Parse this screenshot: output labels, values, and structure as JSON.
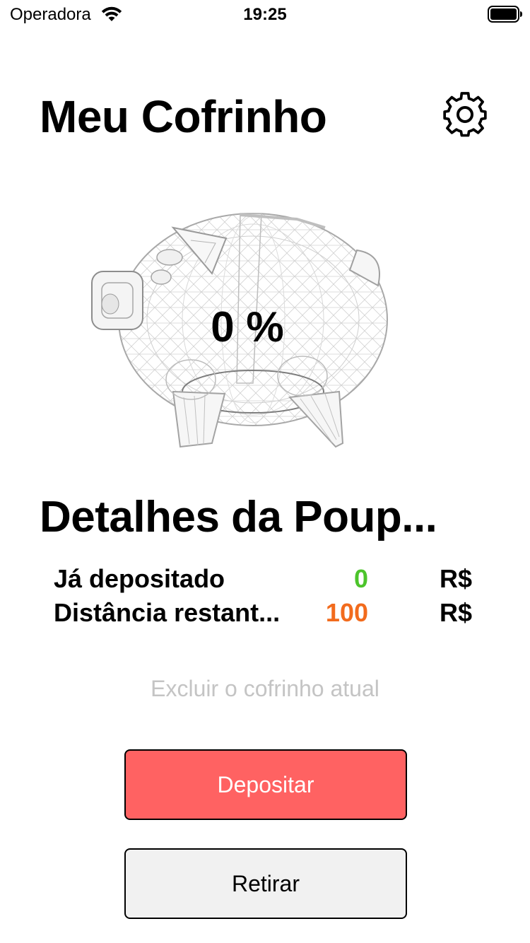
{
  "status_bar": {
    "carrier": "Operadora",
    "time": "19:25",
    "icons": [
      "wifi-icon",
      "battery-icon"
    ]
  },
  "header": {
    "title": "Meu Cofrinho",
    "settings_icon": "gear-icon"
  },
  "piggy_bank": {
    "percent_label": "0 %",
    "illustration": "piggy-bank-wireframe"
  },
  "details": {
    "title": "Detalhes da Poup...",
    "rows": [
      {
        "label": "Já depositado",
        "value": "0",
        "unit": "R$",
        "value_color": "#4cc42b"
      },
      {
        "label": "Distância restant...",
        "value": "100",
        "unit": "R$",
        "value_color": "#f26b1d"
      }
    ]
  },
  "actions": {
    "delete_label": "Excluir o cofrinho atual",
    "deposit_label": "Depositar",
    "withdraw_label": "Retirar"
  },
  "colors": {
    "deposit_button": "#ff6262",
    "withdraw_button": "#f1f1f1",
    "delete_text": "#c4c4c4"
  }
}
